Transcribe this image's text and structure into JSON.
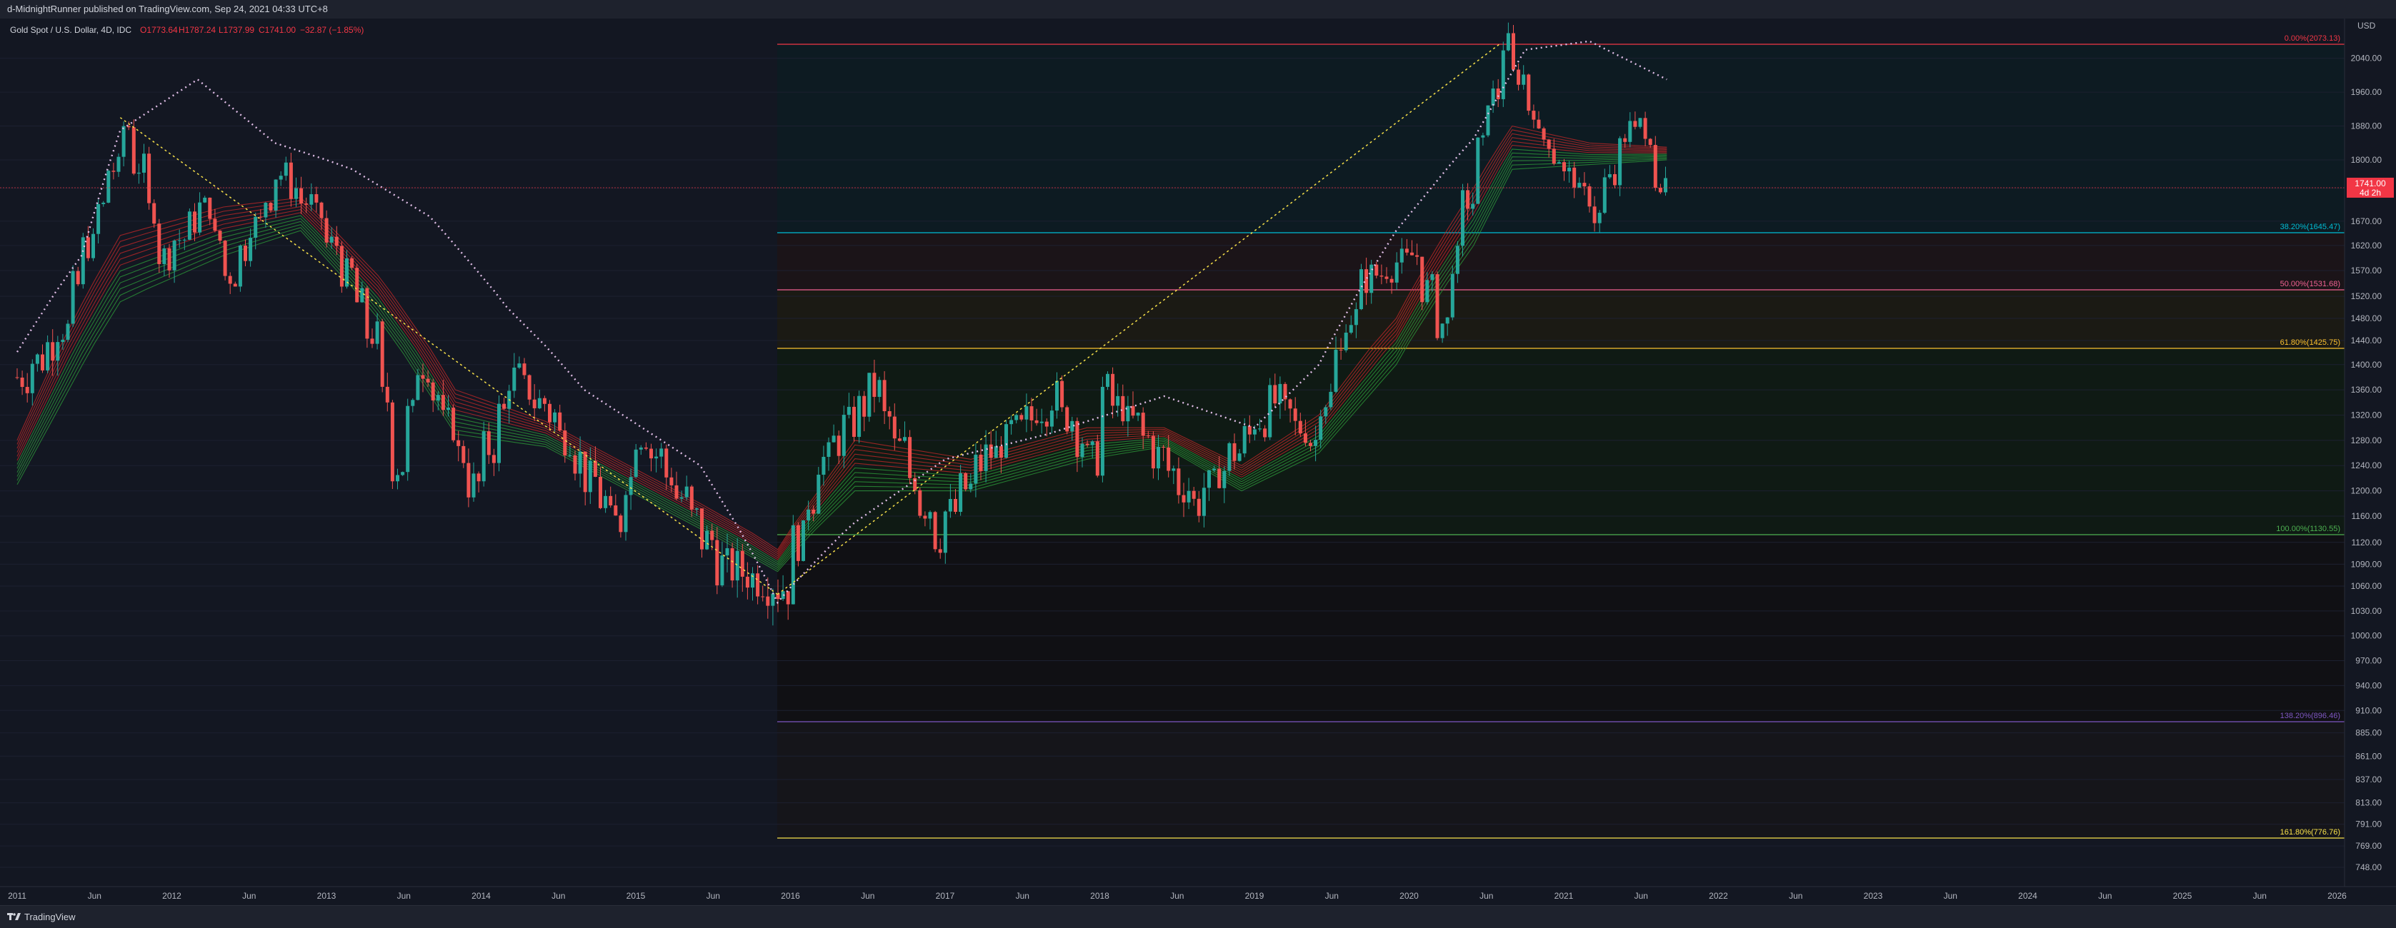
{
  "header": {
    "publisher": "d-MidnightRunner published on TradingView.com, Sep 24, 2021 04:33 UTC+8"
  },
  "footer": {
    "brand": "TradingView"
  },
  "chart_data": {
    "type": "candlestick",
    "instrument": "Gold Spot / U.S. Dollar, 4D, IDC",
    "legend_prefix": "Gold Spot / U.S. Dollar, 4D, IDC",
    "ohlc": {
      "open": "O1773.64",
      "high": "H1787.24",
      "low": "L1737.99",
      "close": "C1741.00",
      "change": "−32.87 (−1.85%)"
    },
    "currency": "USD",
    "price_label": "1741.00",
    "countdown_label": "4d 2h",
    "y_ticks": [
      2040,
      1960,
      1880,
      1800,
      1740,
      1670,
      1620,
      1570,
      1520,
      1480,
      1440,
      1400,
      1360,
      1320,
      1280,
      1240,
      1200,
      1160,
      1120,
      1090,
      1060,
      1030,
      1000,
      970,
      940,
      910,
      885,
      861,
      837,
      813,
      791,
      769,
      748
    ],
    "x_ticks": [
      "2011",
      "Jun",
      "2012",
      "Jun",
      "2013",
      "Jun",
      "2014",
      "Jun",
      "2015",
      "Jun",
      "2016",
      "Jun",
      "2017",
      "Jun",
      "2018",
      "Jun",
      "2019",
      "Jun",
      "2020",
      "Jun",
      "2021",
      "Jun",
      "2022",
      "Jun",
      "2023",
      "Jun",
      "2024",
      "Jun",
      "2025",
      "Jun",
      "2026"
    ],
    "fib_levels": [
      {
        "label": "0.00%(2073.13)",
        "price": 2073.13,
        "color": "#f23645"
      },
      {
        "label": "38.20%(1645.47)",
        "price": 1645.47,
        "color": "#00bcd4"
      },
      {
        "label": "50.00%(1531.68)",
        "price": 1531.68,
        "color": "#f06292"
      },
      {
        "label": "61.80%(1425.75)",
        "price": 1425.75,
        "color": "#fbc02d"
      },
      {
        "label": "100.00%(1130.55)",
        "price": 1130.55,
        "color": "#4caf50"
      },
      {
        "label": "138.20%(896.46)",
        "price": 896.46,
        "color": "#7e57c2"
      },
      {
        "label": "161.80%(776.76)",
        "price": 776.76,
        "color": "#f9e24a"
      }
    ],
    "series": [
      {
        "name": "close_path",
        "points": [
          [
            "2011-01",
            1380
          ],
          [
            "2011-04",
            1460
          ],
          [
            "2011-08",
            1780
          ],
          [
            "2011-09",
            1880
          ],
          [
            "2011-12",
            1600
          ],
          [
            "2012-03",
            1700
          ],
          [
            "2012-05",
            1560
          ],
          [
            "2012-09",
            1770
          ],
          [
            "2012-12",
            1680
          ],
          [
            "2013-04",
            1450
          ],
          [
            "2013-06",
            1240
          ],
          [
            "2013-08",
            1400
          ],
          [
            "2013-12",
            1210
          ],
          [
            "2014-03",
            1380
          ],
          [
            "2014-06",
            1320
          ],
          [
            "2014-11",
            1150
          ],
          [
            "2015-01",
            1290
          ],
          [
            "2015-07",
            1090
          ],
          [
            "2015-12",
            1060
          ],
          [
            "2016-03",
            1250
          ],
          [
            "2016-07",
            1360
          ],
          [
            "2016-12",
            1130
          ],
          [
            "2017-03",
            1240
          ],
          [
            "2017-09",
            1350
          ],
          [
            "2017-12",
            1250
          ],
          [
            "2018-01",
            1360
          ],
          [
            "2018-08",
            1180
          ],
          [
            "2019-02",
            1340
          ],
          [
            "2019-05",
            1280
          ],
          [
            "2019-09",
            1550
          ],
          [
            "2020-01",
            1600
          ],
          [
            "2020-03",
            1470
          ],
          [
            "2020-08",
            2073
          ],
          [
            "2020-11",
            1850
          ],
          [
            "2021-03",
            1680
          ],
          [
            "2021-06",
            1900
          ],
          [
            "2021-08",
            1760
          ],
          [
            "2021-09",
            1741
          ]
        ]
      },
      {
        "name": "upper_band",
        "points": [
          [
            "2011-01",
            1420
          ],
          [
            "2011-06",
            1600
          ],
          [
            "2011-09",
            1870
          ],
          [
            "2012-03",
            1990
          ],
          [
            "2012-09",
            1840
          ],
          [
            "2013-03",
            1780
          ],
          [
            "2013-09",
            1680
          ],
          [
            "2014-03",
            1500
          ],
          [
            "2014-09",
            1360
          ],
          [
            "2015-06",
            1240
          ],
          [
            "2015-12",
            1040
          ],
          [
            "2016-06",
            1150
          ],
          [
            "2017-01",
            1250
          ],
          [
            "2017-09",
            1290
          ],
          [
            "2018-06",
            1350
          ],
          [
            "2019-01",
            1300
          ],
          [
            "2019-06",
            1400
          ],
          [
            "2019-12",
            1650
          ],
          [
            "2020-06",
            1850
          ],
          [
            "2020-10",
            2060
          ],
          [
            "2021-03",
            2080
          ],
          [
            "2021-09",
            1990
          ]
        ]
      },
      {
        "name": "ribbon_upper",
        "points": [
          [
            "2011-01",
            1280
          ],
          [
            "2011-09",
            1640
          ],
          [
            "2012-05",
            1700
          ],
          [
            "2012-11",
            1720
          ],
          [
            "2013-05",
            1560
          ],
          [
            "2013-11",
            1360
          ],
          [
            "2014-06",
            1310
          ],
          [
            "2015-06",
            1180
          ],
          [
            "2015-12",
            1110
          ],
          [
            "2016-06",
            1280
          ],
          [
            "2017-03",
            1250
          ],
          [
            "2017-12",
            1300
          ],
          [
            "2018-06",
            1300
          ],
          [
            "2018-12",
            1240
          ],
          [
            "2019-06",
            1320
          ],
          [
            "2019-12",
            1480
          ],
          [
            "2020-06",
            1740
          ],
          [
            "2020-09",
            1880
          ],
          [
            "2021-03",
            1840
          ],
          [
            "2021-09",
            1830
          ]
        ]
      },
      {
        "name": "ribbon_lower",
        "points": [
          [
            "2011-01",
            1210
          ],
          [
            "2011-09",
            1510
          ],
          [
            "2012-05",
            1600
          ],
          [
            "2012-11",
            1650
          ],
          [
            "2013-05",
            1480
          ],
          [
            "2013-11",
            1290
          ],
          [
            "2014-06",
            1270
          ],
          [
            "2015-06",
            1140
          ],
          [
            "2015-12",
            1080
          ],
          [
            "2016-06",
            1200
          ],
          [
            "2017-03",
            1200
          ],
          [
            "2017-12",
            1250
          ],
          [
            "2018-06",
            1270
          ],
          [
            "2018-12",
            1200
          ],
          [
            "2019-06",
            1260
          ],
          [
            "2019-12",
            1400
          ],
          [
            "2020-06",
            1620
          ],
          [
            "2020-09",
            1780
          ],
          [
            "2021-03",
            1790
          ],
          [
            "2021-09",
            1800
          ]
        ]
      }
    ],
    "trendlines": [
      {
        "from": [
          "2011-09",
          1900
        ],
        "to": [
          "2015-12",
          1050
        ]
      },
      {
        "from": [
          "2015-12",
          1050
        ],
        "to": [
          "2020-08",
          2073
        ]
      }
    ],
    "current_price": 1741
  }
}
